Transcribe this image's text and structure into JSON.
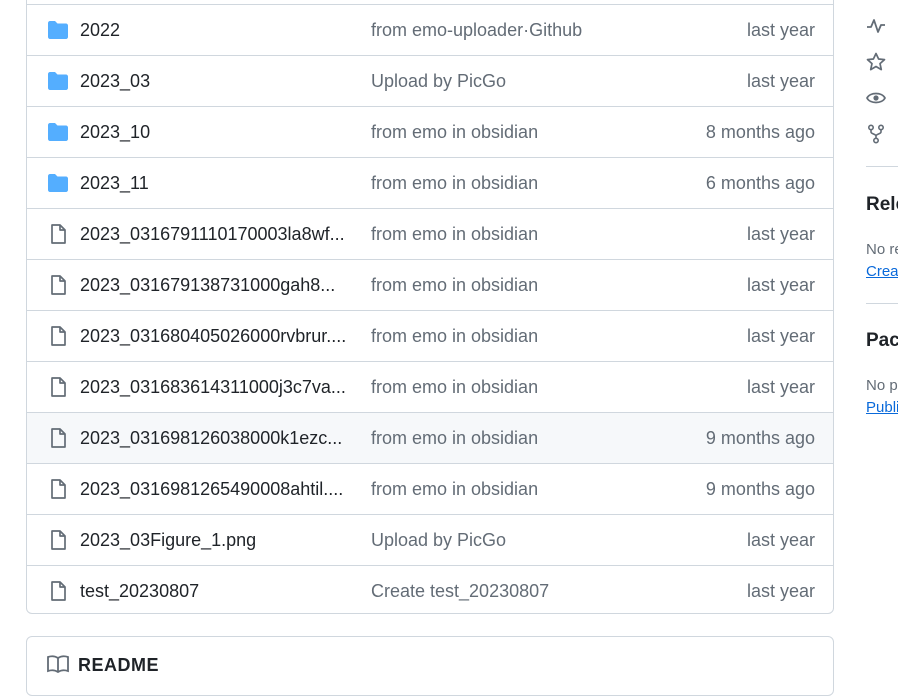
{
  "files": [
    {
      "type": "folder",
      "name": "2022",
      "message": "from emo-uploader·Github",
      "age": "last year"
    },
    {
      "type": "folder",
      "name": "2023_03",
      "message": "Upload by PicGo",
      "age": "last year"
    },
    {
      "type": "folder",
      "name": "2023_10",
      "message": "from emo in obsidian",
      "age": "8 months ago"
    },
    {
      "type": "folder",
      "name": "2023_11",
      "message": "from emo in obsidian",
      "age": "6 months ago"
    },
    {
      "type": "file",
      "name": "2023_0316791110170003la8wf...",
      "message": "from emo in obsidian",
      "age": "last year"
    },
    {
      "type": "file",
      "name": "2023_031679138731000gah8...",
      "message": "from emo in obsidian",
      "age": "last year"
    },
    {
      "type": "file",
      "name": "2023_031680405026000rvbrur....",
      "message": "from emo in obsidian",
      "age": "last year"
    },
    {
      "type": "file",
      "name": "2023_031683614311000j3c7va...",
      "message": "from emo in obsidian",
      "age": "last year"
    },
    {
      "type": "file",
      "name": "2023_031698126038000k1ezc...",
      "message": "from emo in obsidian",
      "age": "9 months ago",
      "highlighted": true
    },
    {
      "type": "file",
      "name": "2023_0316981265490008ahtil....",
      "message": "from emo in obsidian",
      "age": "9 months ago"
    },
    {
      "type": "file",
      "name": "2023_03Figure_1.png",
      "message": "Upload by PicGo",
      "age": "last year"
    },
    {
      "type": "file",
      "name": "test_20230807",
      "message": "Create test_20230807",
      "age": "last year"
    }
  ],
  "readme": {
    "title": "README"
  },
  "sidebar": {
    "icons": [
      "activity-icon",
      "star-icon",
      "eye-icon",
      "fork-icon"
    ],
    "releases": {
      "heading": "Rele",
      "text": "No re",
      "link": "Creat"
    },
    "packages": {
      "heading": "Pac",
      "text": "No p",
      "link": "Publi"
    }
  },
  "colors": {
    "folder": "#54aeff",
    "file_icon": "#636c76",
    "border": "#d0d7de",
    "muted": "#636c76",
    "link": "#0969da",
    "highlight": "#f6f8fa"
  }
}
